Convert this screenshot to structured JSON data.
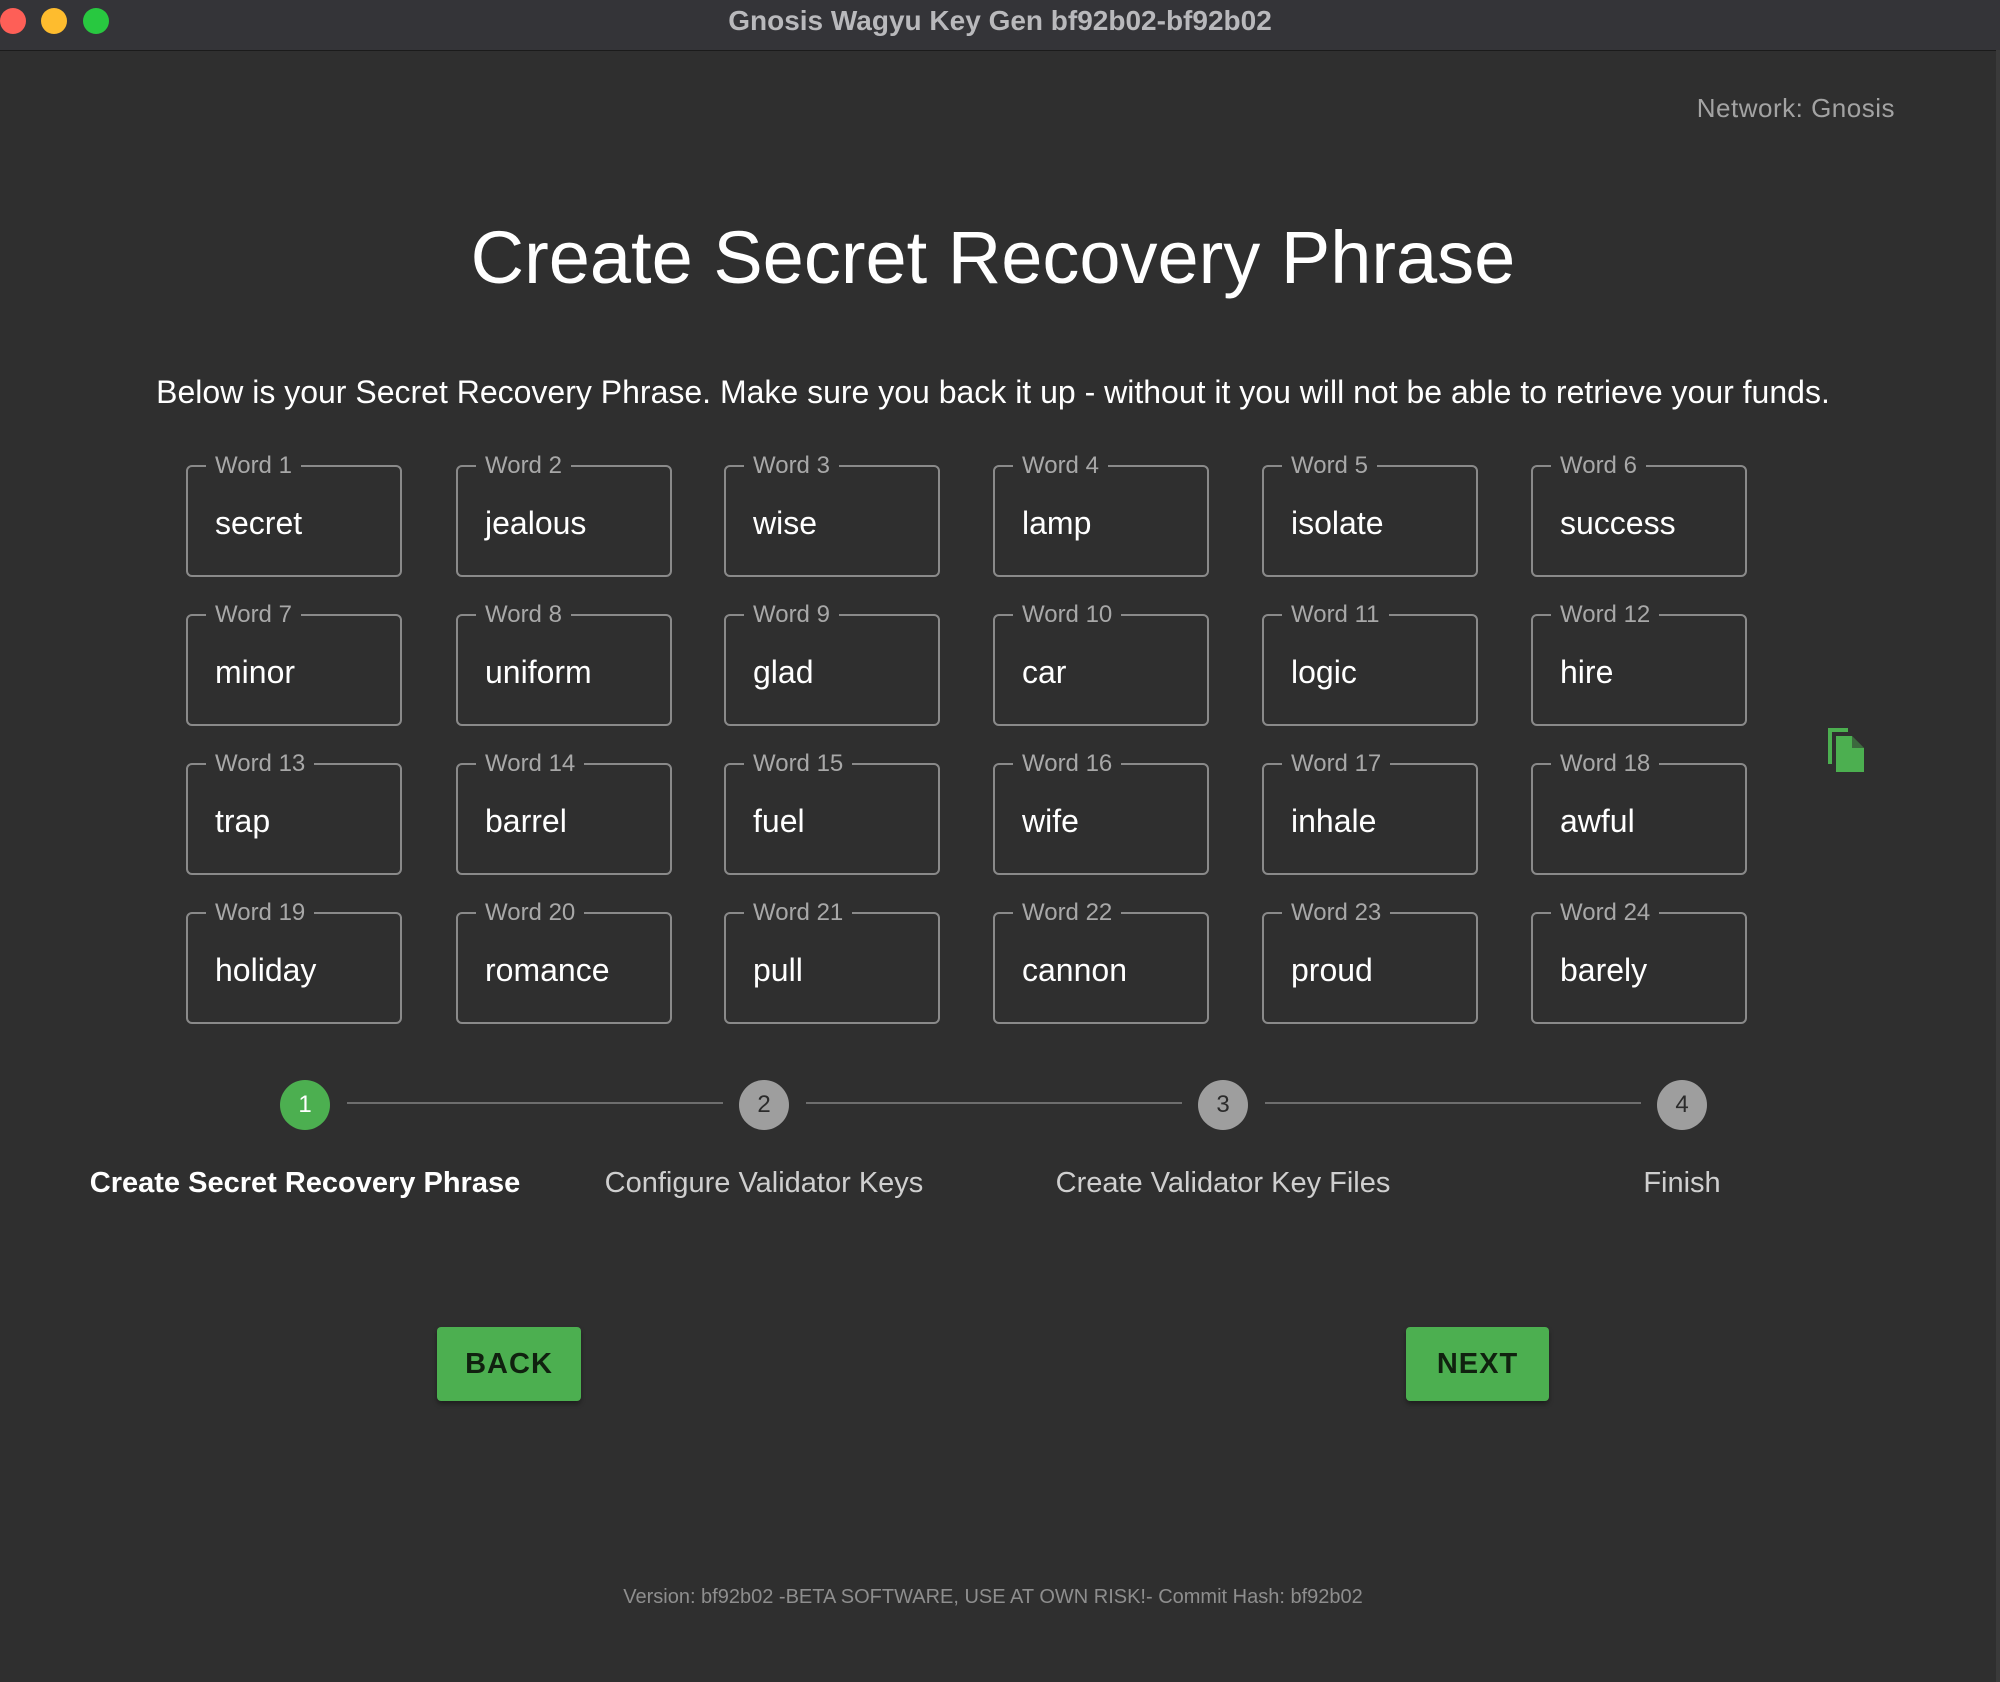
{
  "window": {
    "title": "Gnosis Wagyu Key Gen bf92b02-bf92b02"
  },
  "network_label": "Network: Gnosis",
  "page": {
    "title": "Create Secret Recovery Phrase",
    "subtitle": "Below is your Secret Recovery Phrase. Make sure you back it up - without it you will not be able to retrieve your funds."
  },
  "words": [
    {
      "label": "Word 1",
      "value": "secret"
    },
    {
      "label": "Word 2",
      "value": "jealous"
    },
    {
      "label": "Word 3",
      "value": "wise"
    },
    {
      "label": "Word 4",
      "value": "lamp"
    },
    {
      "label": "Word 5",
      "value": "isolate"
    },
    {
      "label": "Word 6",
      "value": "success"
    },
    {
      "label": "Word 7",
      "value": "minor"
    },
    {
      "label": "Word 8",
      "value": "uniform"
    },
    {
      "label": "Word 9",
      "value": "glad"
    },
    {
      "label": "Word 10",
      "value": "car"
    },
    {
      "label": "Word 11",
      "value": "logic"
    },
    {
      "label": "Word 12",
      "value": "hire"
    },
    {
      "label": "Word 13",
      "value": "trap"
    },
    {
      "label": "Word 14",
      "value": "barrel"
    },
    {
      "label": "Word 15",
      "value": "fuel"
    },
    {
      "label": "Word 16",
      "value": "wife"
    },
    {
      "label": "Word 17",
      "value": "inhale"
    },
    {
      "label": "Word 18",
      "value": "awful"
    },
    {
      "label": "Word 19",
      "value": "holiday"
    },
    {
      "label": "Word 20",
      "value": "romance"
    },
    {
      "label": "Word 21",
      "value": "pull"
    },
    {
      "label": "Word 22",
      "value": "cannon"
    },
    {
      "label": "Word 23",
      "value": "proud"
    },
    {
      "label": "Word 24",
      "value": "barely"
    }
  ],
  "copy_icon": "copy-icon",
  "stepper": {
    "steps": [
      {
        "number": "1",
        "label": "Create Secret Recovery Phrase",
        "active": true
      },
      {
        "number": "2",
        "label": "Configure Validator Keys",
        "active": false
      },
      {
        "number": "3",
        "label": "Create Validator Key Files",
        "active": false
      },
      {
        "number": "4",
        "label": "Finish",
        "active": false
      }
    ]
  },
  "buttons": {
    "back": "BACK",
    "next": "NEXT"
  },
  "footer": "Version: bf92b02 -BETA SOFTWARE, USE AT OWN RISK!- Commit Hash: bf92b02",
  "colors": {
    "accent": "#4caf50",
    "background": "#2f2f2f",
    "inactive_step": "#9e9e9e"
  }
}
